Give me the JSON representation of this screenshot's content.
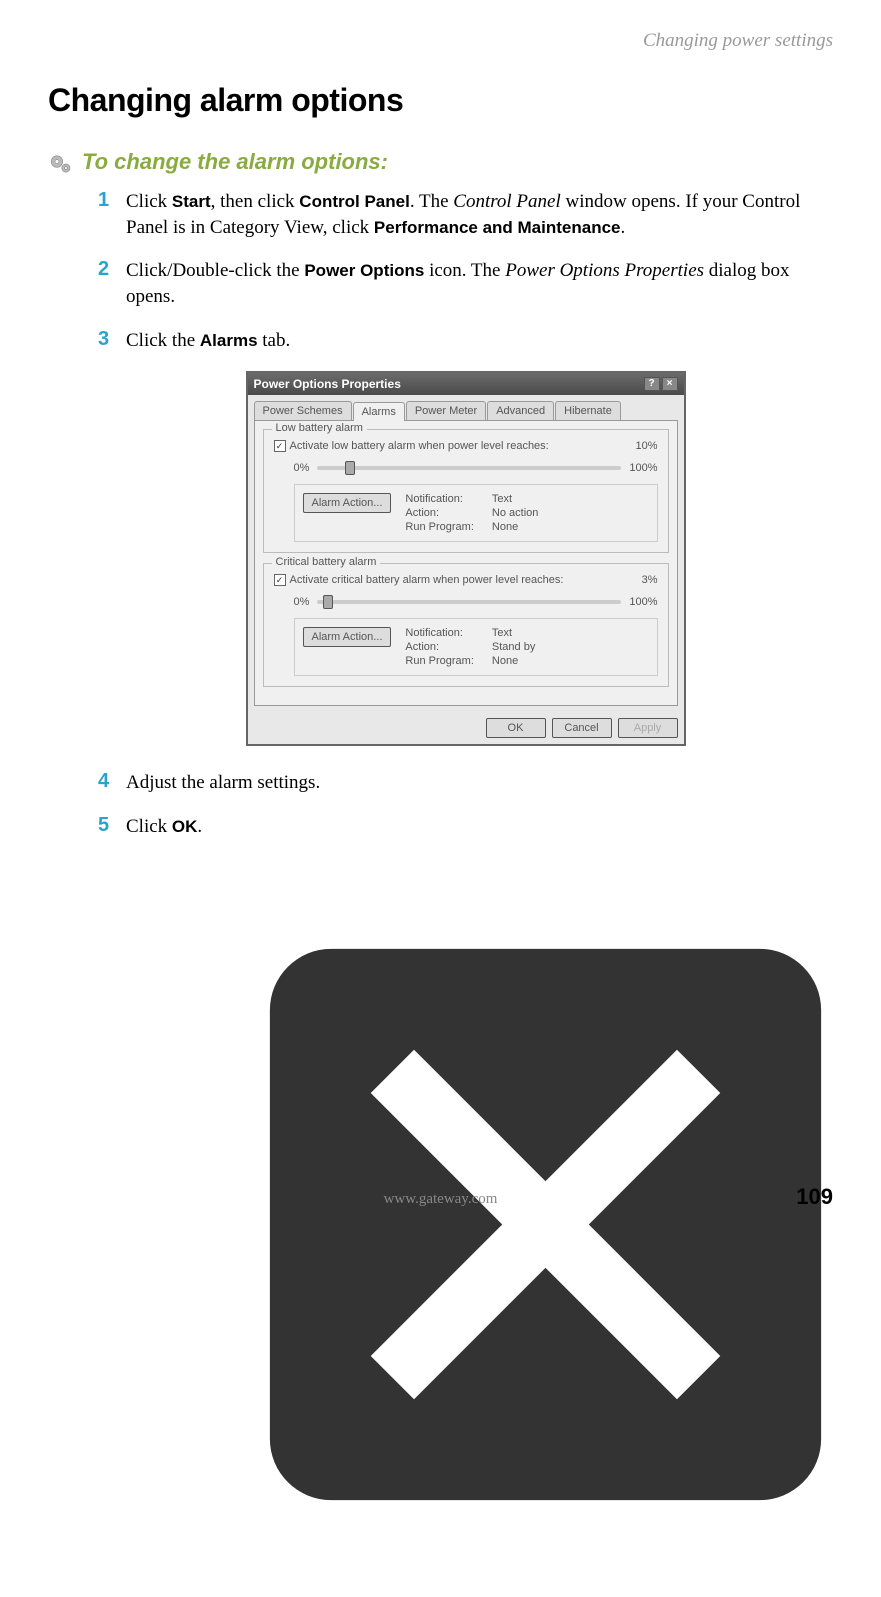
{
  "header": {
    "running_title": "Changing power settings"
  },
  "heading": "Changing alarm options",
  "sub_heading": "To change the alarm options:",
  "steps": {
    "s1": {
      "num": "1",
      "t1": "Click ",
      "b1": "Start",
      "t2": ", then click ",
      "b2": "Control Panel",
      "t3": ". The ",
      "i1": "Control Panel",
      "t4": " window opens. If your Control Panel is in Category View, click ",
      "b3": "Performance and Maintenance",
      "t5": "."
    },
    "s2": {
      "num": "2",
      "t1": "Click/Double-click the ",
      "b1": "Power Options",
      "t2": " icon. The ",
      "i1": "Power Options Properties",
      "t3": " dialog box opens."
    },
    "s3": {
      "num": "3",
      "t1": "Click the ",
      "b1": "Alarms",
      "t2": " tab."
    },
    "s4": {
      "num": "4",
      "t1": "Adjust the alarm settings."
    },
    "s5": {
      "num": "5",
      "t1": "Click ",
      "b1": "OK",
      "t2": "."
    }
  },
  "dialog": {
    "title": "Power Options Properties",
    "tabs": [
      "Power Schemes",
      "Alarms",
      "Power Meter",
      "Advanced",
      "Hibernate"
    ],
    "low": {
      "group_label": "Low battery alarm",
      "checkbox_label": "Activate low battery alarm when power level reaches:",
      "percent": "10%",
      "slider_min": "0%",
      "slider_max": "100%",
      "button": "Alarm Action...",
      "rows": {
        "k1": "Notification:",
        "v1": "Text",
        "k2": "Action:",
        "v2": "No action",
        "k3": "Run Program:",
        "v3": "None"
      }
    },
    "crit": {
      "group_label": "Critical battery alarm",
      "checkbox_label": "Activate critical battery alarm when power level reaches:",
      "percent": "3%",
      "slider_min": "0%",
      "slider_max": "100%",
      "button": "Alarm Action...",
      "rows": {
        "k1": "Notification:",
        "v1": "Text",
        "k2": "Action:",
        "v2": "Stand by",
        "k3": "Run Program:",
        "v3": "None"
      }
    },
    "buttons": {
      "ok": "OK",
      "cancel": "Cancel",
      "apply": "Apply"
    }
  },
  "footer": {
    "url": "www.gateway.com",
    "page": "109"
  }
}
